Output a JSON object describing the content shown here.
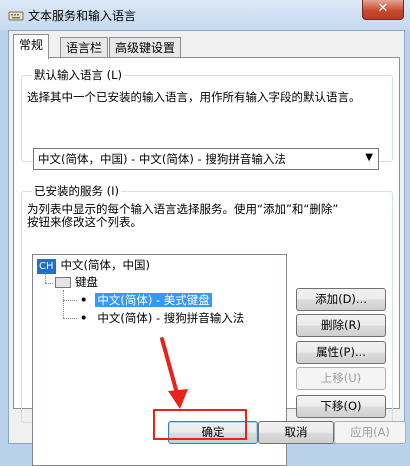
{
  "window": {
    "title": "文本服务和输入语言",
    "close_label": "✕"
  },
  "tabs": [
    {
      "label": "常规",
      "active": true
    },
    {
      "label": "语言栏",
      "active": false
    },
    {
      "label": "高级键设置",
      "active": false
    }
  ],
  "default_input": {
    "legend": "默认输入语言 (L)",
    "description": "选择其中一个已安装的输入语言，用作所有输入字段的默认语言。",
    "selected": "中文(简体，中国) - 中文(简体) - 搜狗拼音输入法"
  },
  "installed": {
    "legend": "已安装的服务 (I)",
    "description_line1": "为列表中显示的每个输入语言选择服务。使用“添加”和“删除”",
    "description_line2": "按钮来修改这个列表。",
    "tree": {
      "lang_code": "CH",
      "language": "中文(简体，中国)",
      "category": "键盘",
      "items": [
        {
          "label": "中文(简体) - 美式键盘",
          "selected": true
        },
        {
          "label": "中文(简体) - 搜狗拼音输入法",
          "selected": false
        }
      ]
    },
    "buttons": {
      "add": "添加(D)...",
      "remove": "删除(R)",
      "properties": "属性(P)...",
      "move_up": "上移(U)",
      "move_down": "下移(O)"
    }
  },
  "footer": {
    "ok": "确定",
    "cancel": "取消",
    "apply": "应用(A)"
  },
  "colors": {
    "annotation": "#e8231c",
    "selection": "#3399ff"
  }
}
